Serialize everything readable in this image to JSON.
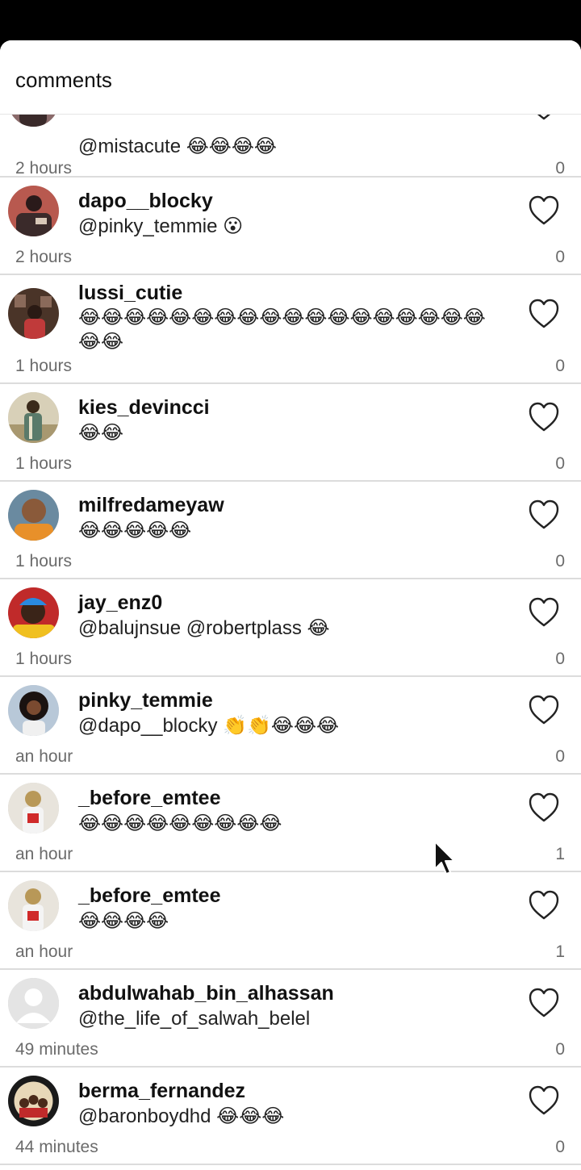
{
  "sheet": {
    "title": "comments"
  },
  "comments": [
    {
      "username": "",
      "text": "@mistacute 😂😂😂😂",
      "time": "2 hours",
      "likes": "0",
      "avatar_color": "#7a5c5c"
    },
    {
      "username": "dapo__blocky",
      "text": "@pinky_temmie 😮",
      "time": "2 hours",
      "likes": "0",
      "avatar_color": "#b04a4a"
    },
    {
      "username": "lussi_cutie",
      "text": "😂😂😂😂😂😂😂😂😂😂😂😂😂😂😂😂😂😂😂😂",
      "time": "1 hours",
      "likes": "0",
      "avatar_color": "#5a3a2a"
    },
    {
      "username": "kies_devincci",
      "text": "😂😂",
      "time": "1 hours",
      "likes": "0",
      "avatar_color": "#8a8a6a"
    },
    {
      "username": "milfredameyaw",
      "text": "😂😂😂😂😂",
      "time": "1 hours",
      "likes": "0",
      "avatar_color": "#d08a3a"
    },
    {
      "username": "jay_enz0",
      "text": "@balujnsue @robertplass 😂",
      "time": "1 hours",
      "likes": "0",
      "avatar_color": "#e0b020"
    },
    {
      "username": "pinky_temmie",
      "text": "@dapo__blocky 👏👏😂😂😂",
      "time": "an hour",
      "likes": "0",
      "avatar_color": "#6a4a3a"
    },
    {
      "username": "_before_emtee",
      "text": "😂😂😂😂😂😂😂😂😂",
      "time": "an hour",
      "likes": "1",
      "avatar_color": "#c8b89a"
    },
    {
      "username": "_before_emtee",
      "text": "😂😂😂😂",
      "time": "an hour",
      "likes": "1",
      "avatar_color": "#c8b89a"
    },
    {
      "username": "abdulwahab_bin_alhassan",
      "text": "@the_life_of_salwah_belel",
      "time": "49 minutes",
      "likes": "0",
      "avatar_color": "#e3e3e3"
    },
    {
      "username": "berma_fernandez",
      "text": "@baronboydhd 😂😂😂",
      "time": "44 minutes",
      "likes": "0",
      "avatar_color": "#3a3a3a"
    }
  ]
}
